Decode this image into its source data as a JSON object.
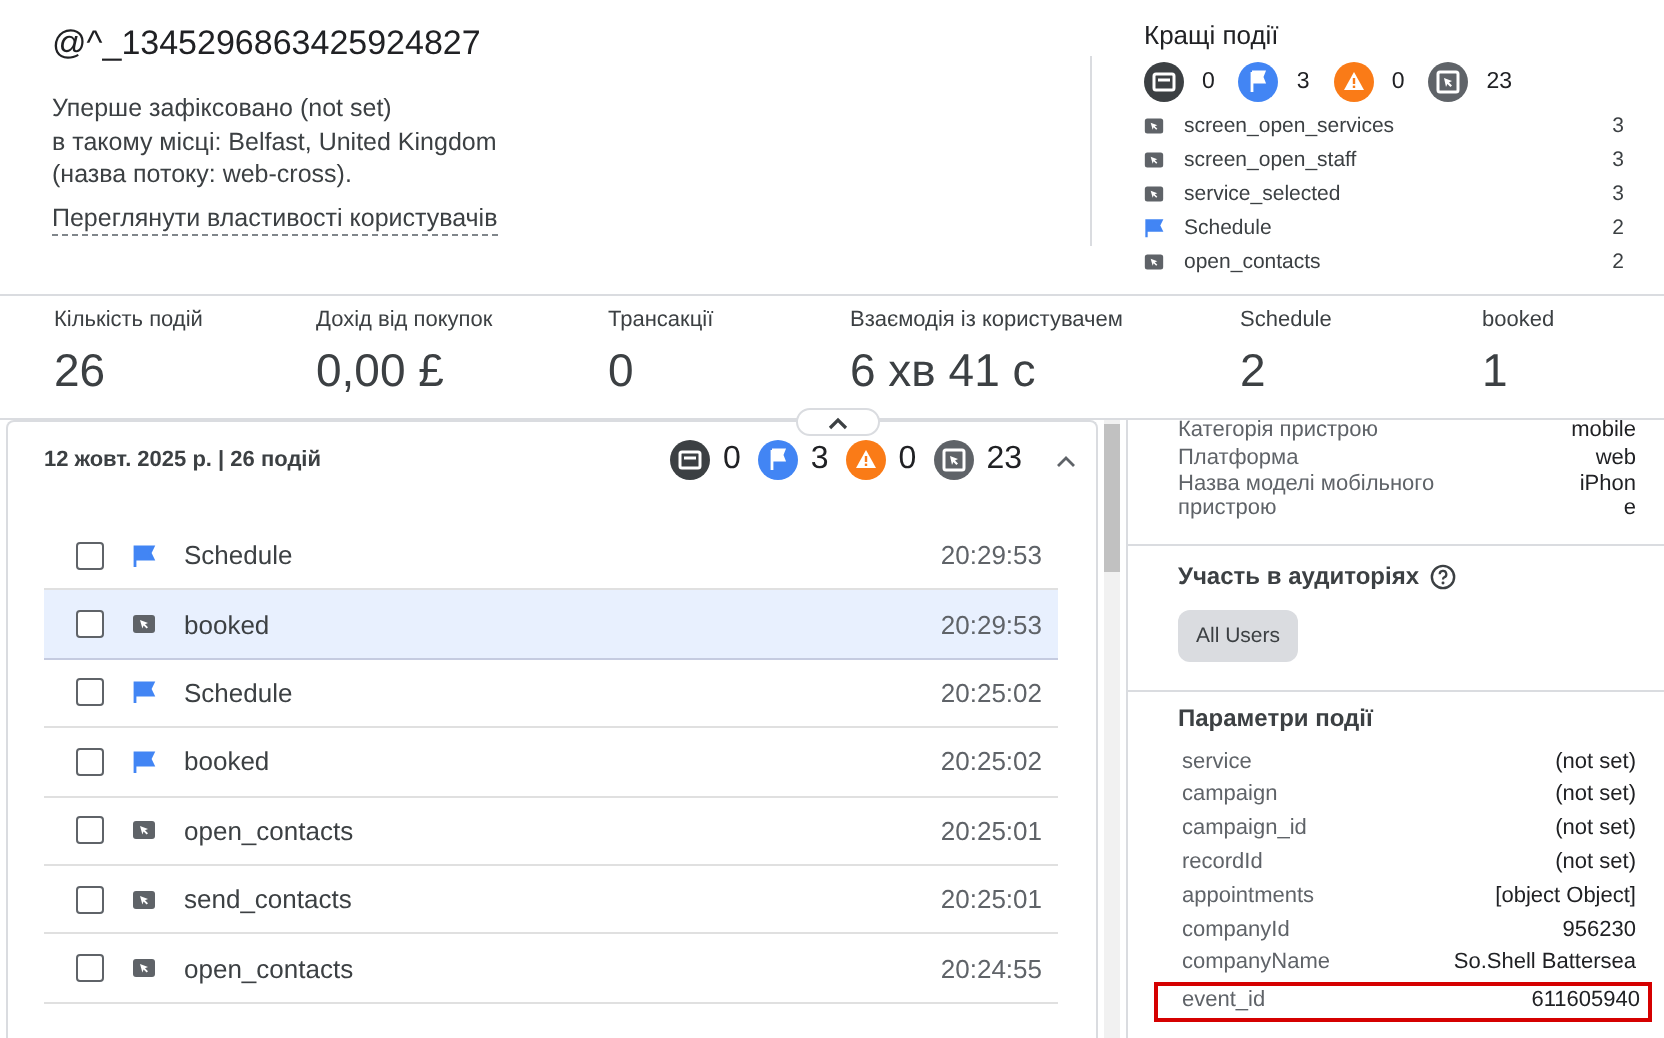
{
  "user": {
    "title": "@^_1345296863425924827",
    "lines": [
      "Уперше зафіксовано (not set)",
      "в такому місці: Belfast, United Kingdom",
      "(назва потоку: web-cross)."
    ],
    "link": "Переглянути властивості користувачів"
  },
  "top_events": {
    "title": "Кращі події",
    "counts": [
      {
        "kind": "screen",
        "count": "0"
      },
      {
        "kind": "flag",
        "count": "3"
      },
      {
        "kind": "warning",
        "count": "0"
      },
      {
        "kind": "click",
        "count": "23"
      }
    ],
    "items": [
      {
        "kind": "click",
        "name": "screen_open_services",
        "count": "3"
      },
      {
        "kind": "click",
        "name": "screen_open_staff",
        "count": "3"
      },
      {
        "kind": "click",
        "name": "service_selected",
        "count": "3"
      },
      {
        "kind": "flag",
        "name": "Schedule",
        "count": "2"
      },
      {
        "kind": "click",
        "name": "open_contacts",
        "count": "2"
      }
    ]
  },
  "metrics": [
    {
      "label": "Кількість подій",
      "value": "26"
    },
    {
      "label": "Дохід від покупок",
      "value": "0,00 £"
    },
    {
      "label": "Трансакції",
      "value": "0"
    },
    {
      "label": "Взаємодія із користувачем",
      "value": "6 хв 41 с"
    },
    {
      "label": "Schedule",
      "value": "2"
    },
    {
      "label": "booked",
      "value": "1"
    }
  ],
  "timeline": {
    "date": "12 жовт. 2025 р. | 26 подій",
    "counts": [
      {
        "kind": "screen",
        "count": "0"
      },
      {
        "kind": "flag",
        "count": "3"
      },
      {
        "kind": "warning",
        "count": "0"
      },
      {
        "kind": "click",
        "count": "23"
      }
    ],
    "rows": [
      {
        "kind": "flag",
        "name": "Schedule",
        "time": "20:29:53",
        "checked": false,
        "selected": false
      },
      {
        "kind": "click",
        "name": "booked",
        "time": "20:29:53",
        "checked": false,
        "selected": true
      },
      {
        "kind": "flag",
        "name": "Schedule",
        "time": "20:25:02",
        "checked": false,
        "selected": false
      },
      {
        "kind": "flag",
        "name": "booked",
        "time": "20:25:02",
        "checked": false,
        "selected": false
      },
      {
        "kind": "click",
        "name": "open_contacts",
        "time": "20:25:01",
        "checked": false,
        "selected": false
      },
      {
        "kind": "click",
        "name": "send_contacts",
        "time": "20:25:01",
        "checked": false,
        "selected": false
      },
      {
        "kind": "click",
        "name": "open_contacts",
        "time": "20:24:55",
        "checked": false,
        "selected": false
      }
    ]
  },
  "details": {
    "device": [
      {
        "key": "Категорія пристрою",
        "value": "mobile"
      },
      {
        "key": "Платформа",
        "value": "web"
      },
      {
        "key": "Назва моделі мобільного пристрою",
        "value": "iPhone"
      }
    ],
    "audiences_title": "Участь в аудиторіях",
    "audiences": [
      "All Users"
    ],
    "params_title": "Параметри події",
    "params": [
      {
        "key": "service",
        "value": "(not set)",
        "highlighted": false
      },
      {
        "key": "campaign",
        "value": "(not set)",
        "highlighted": false
      },
      {
        "key": "campaign_id",
        "value": "(not set)",
        "highlighted": false
      },
      {
        "key": "recordId",
        "value": "(not set)",
        "highlighted": false
      },
      {
        "key": "appointments",
        "value": "[object Object]",
        "highlighted": false
      },
      {
        "key": "companyId",
        "value": "956230",
        "highlighted": false
      },
      {
        "key": "companyName",
        "value": "So.Shell Battersea",
        "highlighted": false
      },
      {
        "key": "event_id",
        "value": "611605940",
        "highlighted": true
      }
    ]
  }
}
